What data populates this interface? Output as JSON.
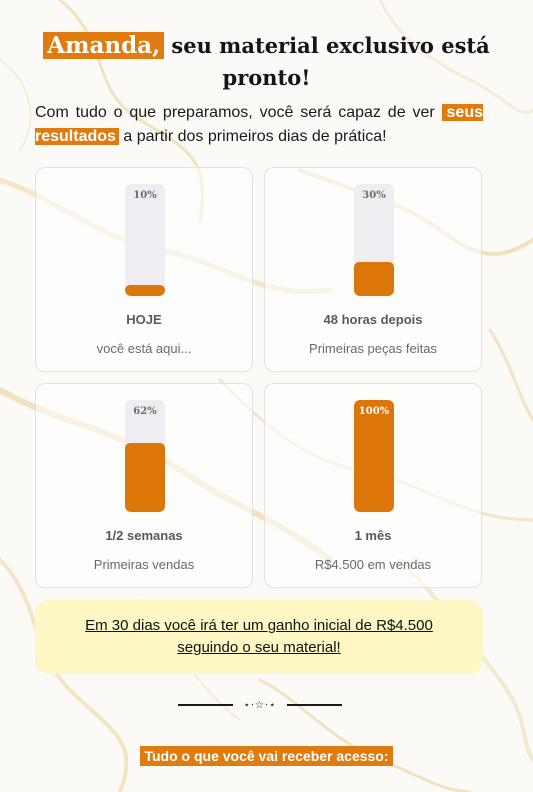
{
  "headline": {
    "name": "Amanda,",
    "rest": " seu material exclusivo está pronto!"
  },
  "lead": {
    "before": "Com tudo o que preparamos, você será capaz de ver ",
    "highlight": "seus resultados",
    "after": " a partir dos primeiros dias de prática!"
  },
  "progress_cards": [
    {
      "percent_label": "10%",
      "percent": 10,
      "title": "HOJE",
      "subtitle": "você está aqui..."
    },
    {
      "percent_label": "30%",
      "percent": 30,
      "title": "48 horas depois",
      "subtitle": "Primeiras peças feitas"
    },
    {
      "percent_label": "62%",
      "percent": 62,
      "title": "1/2 semanas",
      "subtitle": "Primeiras vendas"
    },
    {
      "percent_label": "100%",
      "percent": 100,
      "title": "1 mês",
      "subtitle": "R$4.500 em vendas"
    }
  ],
  "callout": {
    "text": "Em 30 dias você irá ter um ganho inicial de R$4.500 seguindo o seu material!"
  },
  "divider": {
    "ornament": "⋆·☆·⋆"
  },
  "access": {
    "label": "Tudo o que você vai receber acesso:"
  },
  "colors": {
    "accent": "#e07b0f",
    "bar_fill": "#dc7608",
    "bar_track": "#eeeef2",
    "callout_bg": "#fdf7c4"
  }
}
